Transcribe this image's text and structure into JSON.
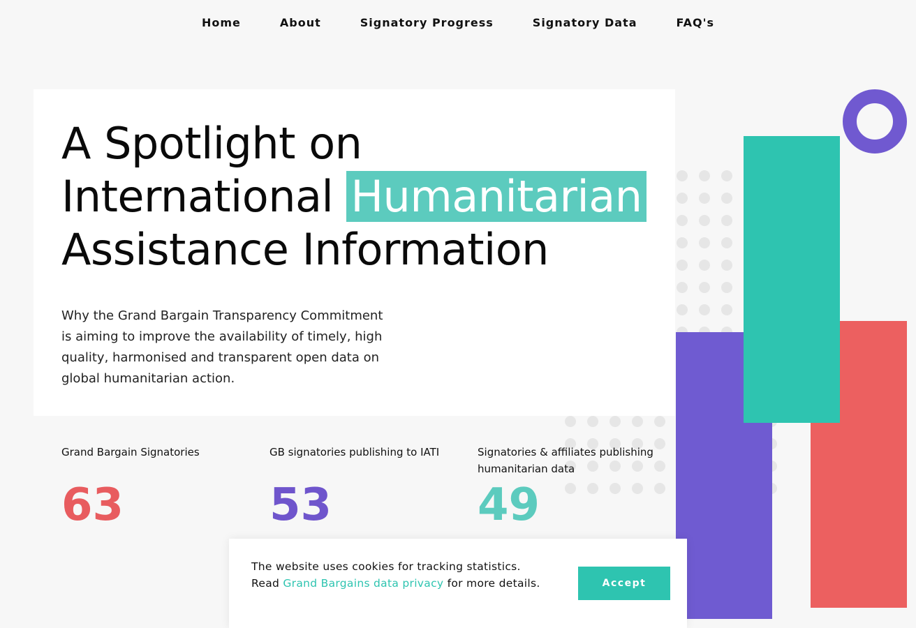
{
  "nav": {
    "items": [
      "Home",
      "About",
      "Signatory Progress",
      "Signatory Data",
      "FAQ's"
    ]
  },
  "hero": {
    "title_line1": "A Spotlight on",
    "title_line2_prefix": "International ",
    "title_highlight": "Humanitarian",
    "title_line3": "Assistance Information",
    "description": "Why the Grand Bargain Transparency Commitment is aiming to improve the availability of timely, high quality, harmonised and transparent open data on global humanitarian action."
  },
  "stats": [
    {
      "label": "Grand Bargain Signatories",
      "value": "63",
      "color": "#e85c5f"
    },
    {
      "label": "GB signatories publishing to IATI",
      "value": "53",
      "color": "#6f55cc"
    },
    {
      "label": "Signatories & affiliates publishing humanitarian data",
      "value": "49",
      "color": "#5ccbbe"
    }
  ],
  "cookie": {
    "text_before": "The website uses cookies for tracking statistics. Read ",
    "link_text": "Grand Bargains data privacy",
    "text_after": " for more details.",
    "accept_label": "Accept"
  },
  "colors": {
    "teal": "#2ec4b0",
    "purple": "#6f5bd1",
    "red": "#ec6060",
    "highlight": "#5ccbbe"
  }
}
